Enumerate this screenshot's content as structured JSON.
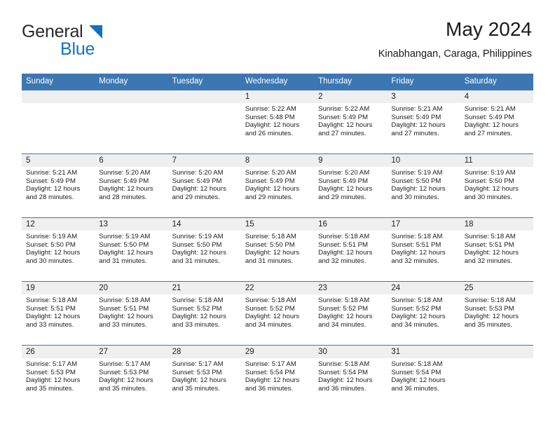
{
  "brand": {
    "name_top": "General",
    "name_bottom": "Blue",
    "triangle_color": "#1273bd",
    "text_color": "#27292b"
  },
  "header": {
    "title": "May 2024",
    "subtitle": "Kinabhangan, Caraga, Philippines"
  },
  "theme": {
    "header_blue": "#3c77b4",
    "daynum_band": "#efefef",
    "cell_background": "#ffffff",
    "text": "#1d1d1d"
  },
  "calendar": {
    "day_headers": [
      "Sunday",
      "Monday",
      "Tuesday",
      "Wednesday",
      "Thursday",
      "Friday",
      "Saturday"
    ],
    "weeks": [
      [
        {
          "day": "",
          "empty": true
        },
        {
          "day": "",
          "empty": true
        },
        {
          "day": "",
          "empty": true
        },
        {
          "day": "1",
          "sunrise": "Sunrise: 5:22 AM",
          "sunset": "Sunset: 5:48 PM",
          "daylight_line1": "Daylight: 12 hours",
          "daylight_line2": "and 26 minutes."
        },
        {
          "day": "2",
          "sunrise": "Sunrise: 5:22 AM",
          "sunset": "Sunset: 5:49 PM",
          "daylight_line1": "Daylight: 12 hours",
          "daylight_line2": "and 27 minutes."
        },
        {
          "day": "3",
          "sunrise": "Sunrise: 5:21 AM",
          "sunset": "Sunset: 5:49 PM",
          "daylight_line1": "Daylight: 12 hours",
          "daylight_line2": "and 27 minutes."
        },
        {
          "day": "4",
          "sunrise": "Sunrise: 5:21 AM",
          "sunset": "Sunset: 5:49 PM",
          "daylight_line1": "Daylight: 12 hours",
          "daylight_line2": "and 27 minutes."
        }
      ],
      [
        {
          "day": "5",
          "sunrise": "Sunrise: 5:21 AM",
          "sunset": "Sunset: 5:49 PM",
          "daylight_line1": "Daylight: 12 hours",
          "daylight_line2": "and 28 minutes."
        },
        {
          "day": "6",
          "sunrise": "Sunrise: 5:20 AM",
          "sunset": "Sunset: 5:49 PM",
          "daylight_line1": "Daylight: 12 hours",
          "daylight_line2": "and 28 minutes."
        },
        {
          "day": "7",
          "sunrise": "Sunrise: 5:20 AM",
          "sunset": "Sunset: 5:49 PM",
          "daylight_line1": "Daylight: 12 hours",
          "daylight_line2": "and 29 minutes."
        },
        {
          "day": "8",
          "sunrise": "Sunrise: 5:20 AM",
          "sunset": "Sunset: 5:49 PM",
          "daylight_line1": "Daylight: 12 hours",
          "daylight_line2": "and 29 minutes."
        },
        {
          "day": "9",
          "sunrise": "Sunrise: 5:20 AM",
          "sunset": "Sunset: 5:49 PM",
          "daylight_line1": "Daylight: 12 hours",
          "daylight_line2": "and 29 minutes."
        },
        {
          "day": "10",
          "sunrise": "Sunrise: 5:19 AM",
          "sunset": "Sunset: 5:50 PM",
          "daylight_line1": "Daylight: 12 hours",
          "daylight_line2": "and 30 minutes."
        },
        {
          "day": "11",
          "sunrise": "Sunrise: 5:19 AM",
          "sunset": "Sunset: 5:50 PM",
          "daylight_line1": "Daylight: 12 hours",
          "daylight_line2": "and 30 minutes."
        }
      ],
      [
        {
          "day": "12",
          "sunrise": "Sunrise: 5:19 AM",
          "sunset": "Sunset: 5:50 PM",
          "daylight_line1": "Daylight: 12 hours",
          "daylight_line2": "and 30 minutes."
        },
        {
          "day": "13",
          "sunrise": "Sunrise: 5:19 AM",
          "sunset": "Sunset: 5:50 PM",
          "daylight_line1": "Daylight: 12 hours",
          "daylight_line2": "and 31 minutes."
        },
        {
          "day": "14",
          "sunrise": "Sunrise: 5:19 AM",
          "sunset": "Sunset: 5:50 PM",
          "daylight_line1": "Daylight: 12 hours",
          "daylight_line2": "and 31 minutes."
        },
        {
          "day": "15",
          "sunrise": "Sunrise: 5:18 AM",
          "sunset": "Sunset: 5:50 PM",
          "daylight_line1": "Daylight: 12 hours",
          "daylight_line2": "and 31 minutes."
        },
        {
          "day": "16",
          "sunrise": "Sunrise: 5:18 AM",
          "sunset": "Sunset: 5:51 PM",
          "daylight_line1": "Daylight: 12 hours",
          "daylight_line2": "and 32 minutes."
        },
        {
          "day": "17",
          "sunrise": "Sunrise: 5:18 AM",
          "sunset": "Sunset: 5:51 PM",
          "daylight_line1": "Daylight: 12 hours",
          "daylight_line2": "and 32 minutes."
        },
        {
          "day": "18",
          "sunrise": "Sunrise: 5:18 AM",
          "sunset": "Sunset: 5:51 PM",
          "daylight_line1": "Daylight: 12 hours",
          "daylight_line2": "and 32 minutes."
        }
      ],
      [
        {
          "day": "19",
          "sunrise": "Sunrise: 5:18 AM",
          "sunset": "Sunset: 5:51 PM",
          "daylight_line1": "Daylight: 12 hours",
          "daylight_line2": "and 33 minutes."
        },
        {
          "day": "20",
          "sunrise": "Sunrise: 5:18 AM",
          "sunset": "Sunset: 5:51 PM",
          "daylight_line1": "Daylight: 12 hours",
          "daylight_line2": "and 33 minutes."
        },
        {
          "day": "21",
          "sunrise": "Sunrise: 5:18 AM",
          "sunset": "Sunset: 5:52 PM",
          "daylight_line1": "Daylight: 12 hours",
          "daylight_line2": "and 33 minutes."
        },
        {
          "day": "22",
          "sunrise": "Sunrise: 5:18 AM",
          "sunset": "Sunset: 5:52 PM",
          "daylight_line1": "Daylight: 12 hours",
          "daylight_line2": "and 34 minutes."
        },
        {
          "day": "23",
          "sunrise": "Sunrise: 5:18 AM",
          "sunset": "Sunset: 5:52 PM",
          "daylight_line1": "Daylight: 12 hours",
          "daylight_line2": "and 34 minutes."
        },
        {
          "day": "24",
          "sunrise": "Sunrise: 5:18 AM",
          "sunset": "Sunset: 5:52 PM",
          "daylight_line1": "Daylight: 12 hours",
          "daylight_line2": "and 34 minutes."
        },
        {
          "day": "25",
          "sunrise": "Sunrise: 5:18 AM",
          "sunset": "Sunset: 5:53 PM",
          "daylight_line1": "Daylight: 12 hours",
          "daylight_line2": "and 35 minutes."
        }
      ],
      [
        {
          "day": "26",
          "sunrise": "Sunrise: 5:17 AM",
          "sunset": "Sunset: 5:53 PM",
          "daylight_line1": "Daylight: 12 hours",
          "daylight_line2": "and 35 minutes."
        },
        {
          "day": "27",
          "sunrise": "Sunrise: 5:17 AM",
          "sunset": "Sunset: 5:53 PM",
          "daylight_line1": "Daylight: 12 hours",
          "daylight_line2": "and 35 minutes."
        },
        {
          "day": "28",
          "sunrise": "Sunrise: 5:17 AM",
          "sunset": "Sunset: 5:53 PM",
          "daylight_line1": "Daylight: 12 hours",
          "daylight_line2": "and 35 minutes."
        },
        {
          "day": "29",
          "sunrise": "Sunrise: 5:17 AM",
          "sunset": "Sunset: 5:54 PM",
          "daylight_line1": "Daylight: 12 hours",
          "daylight_line2": "and 36 minutes."
        },
        {
          "day": "30",
          "sunrise": "Sunrise: 5:18 AM",
          "sunset": "Sunset: 5:54 PM",
          "daylight_line1": "Daylight: 12 hours",
          "daylight_line2": "and 36 minutes."
        },
        {
          "day": "31",
          "sunrise": "Sunrise: 5:18 AM",
          "sunset": "Sunset: 5:54 PM",
          "daylight_line1": "Daylight: 12 hours",
          "daylight_line2": "and 36 minutes."
        },
        {
          "day": "",
          "empty": true
        }
      ]
    ]
  }
}
